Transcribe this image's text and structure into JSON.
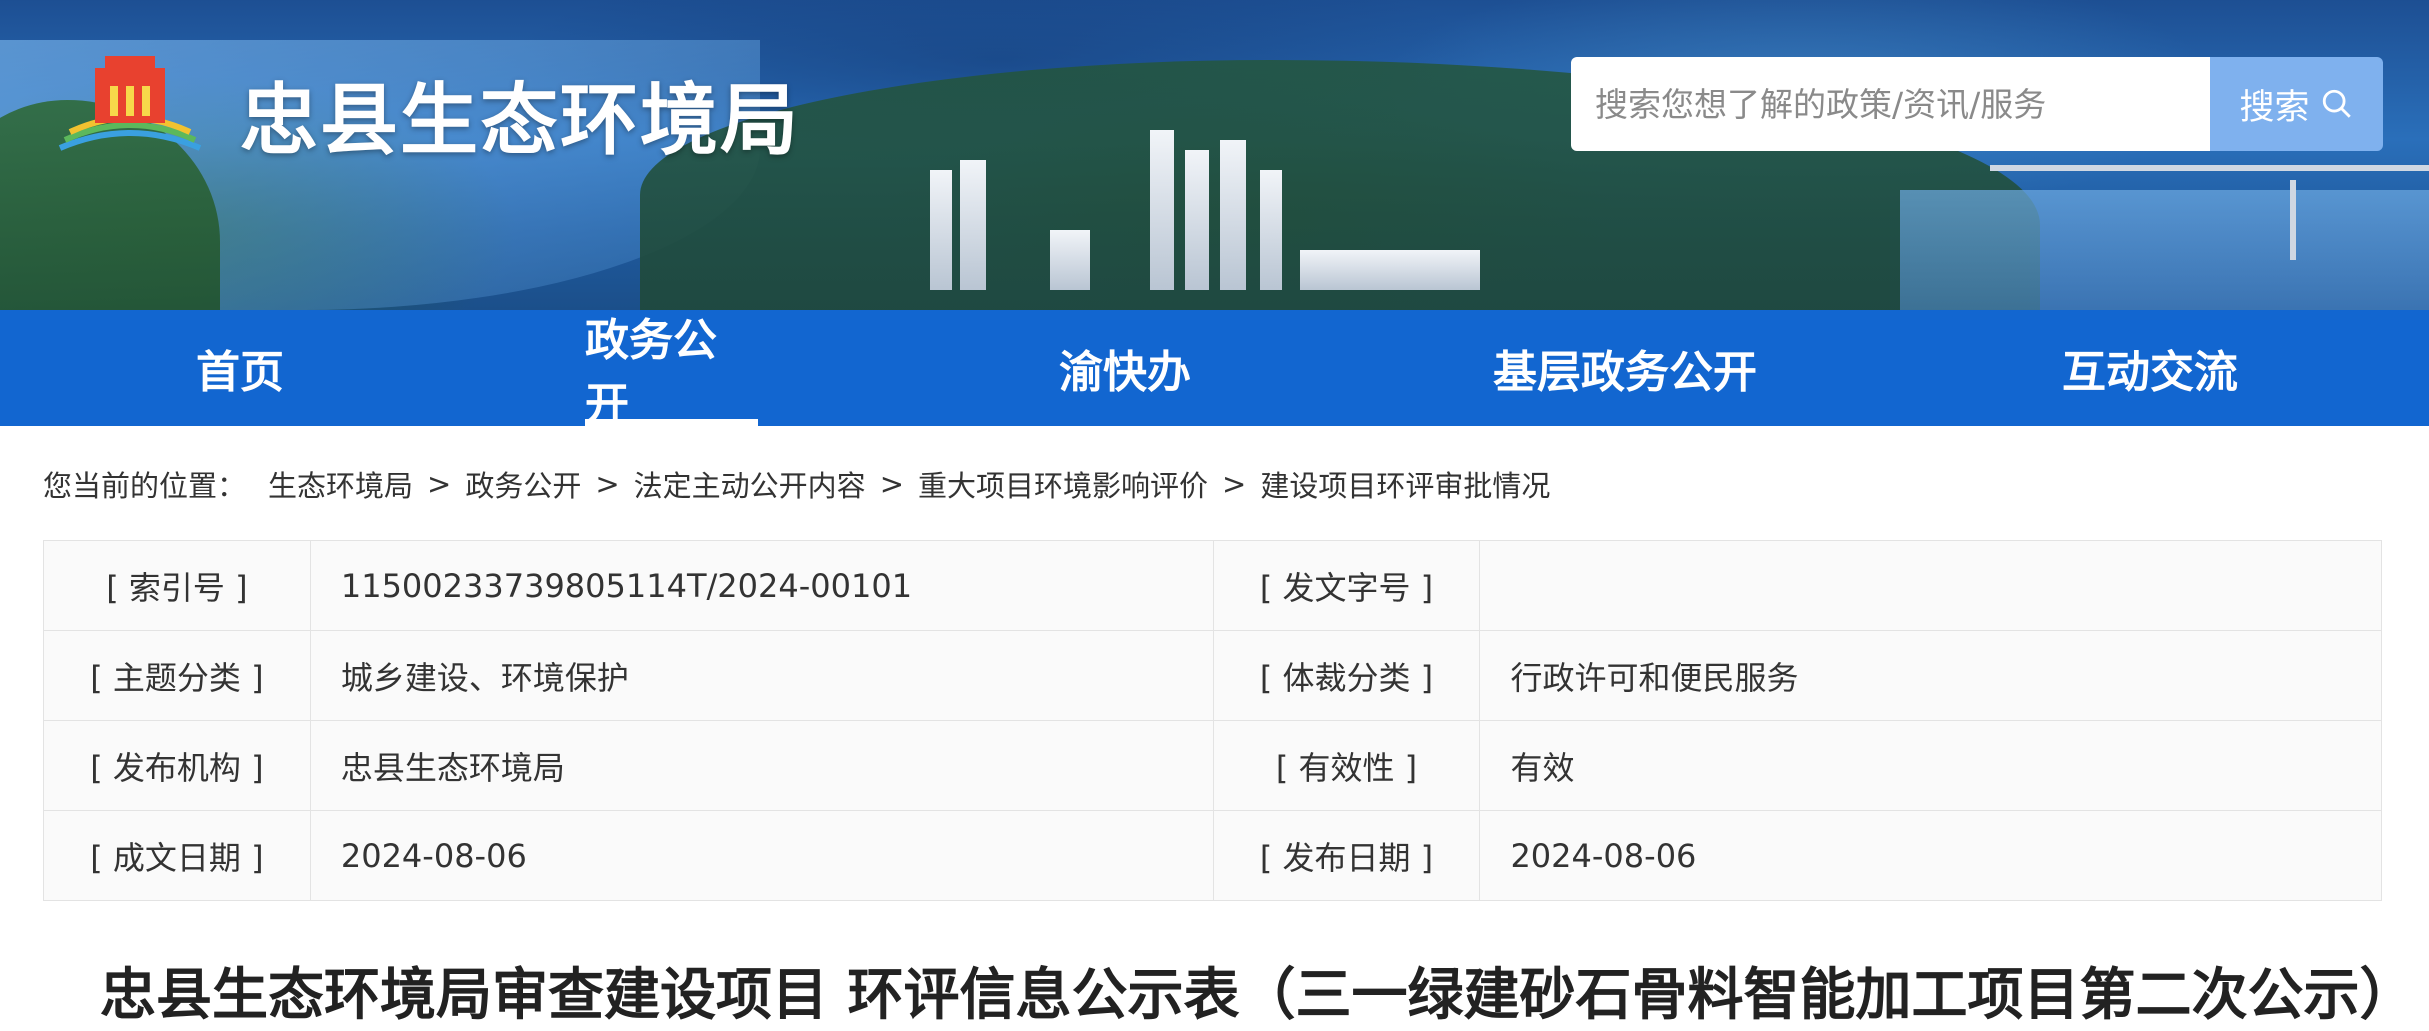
{
  "header": {
    "site_title": "忠县生态环境局",
    "search": {
      "placeholder": "搜索您想了解的政策/资讯/服务",
      "button_label": "搜索"
    }
  },
  "nav": {
    "items": [
      {
        "label": "首页"
      },
      {
        "label": "政务公开"
      },
      {
        "label": "渝快办"
      },
      {
        "label": "基层政务公开"
      },
      {
        "label": "互动交流"
      }
    ],
    "active_index": 1
  },
  "breadcrumb": {
    "prefix": "您当前的位置：",
    "items": [
      "生态环境局",
      "政务公开",
      "法定主动公开内容",
      "重大项目环境影响评价",
      "建设项目环评审批情况"
    ],
    "separator": ">"
  },
  "info": {
    "rows": [
      {
        "l1": "[ 索引号 ]",
        "v1": "11500233739805114T/2024-00101",
        "l2": "[ 发文字号 ]",
        "v2": ""
      },
      {
        "l1": "[ 主题分类 ]",
        "v1": "城乡建设、环境保护",
        "l2": "[ 体裁分类 ]",
        "v2": "行政许可和便民服务"
      },
      {
        "l1": "[ 发布机构 ]",
        "v1": "忠县生态环境局",
        "l2": "[ 有效性 ]",
        "v2": "有效"
      },
      {
        "l1": "[ 成文日期 ]",
        "v1": "2024-08-06",
        "l2": "[ 发布日期 ]",
        "v2": "2024-08-06"
      }
    ]
  },
  "article": {
    "title": "忠县生态环境局审查建设项目 环评信息公示表（三一绿建砂石骨料智能加工项目第二次公示）"
  },
  "colors": {
    "nav_bg": "#1266d0",
    "search_button_bg": "#7fb1ee"
  }
}
